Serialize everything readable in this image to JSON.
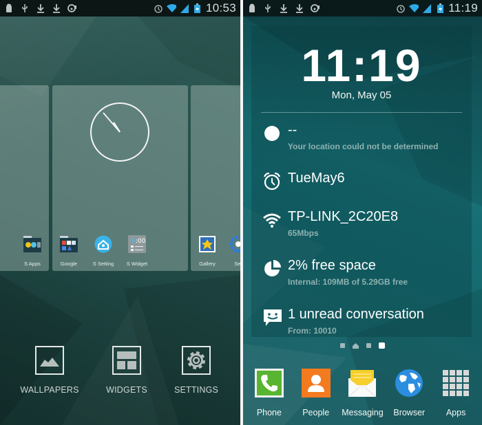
{
  "left_screen": {
    "status_bar": {
      "notification_icons": [
        "android-debug-icon",
        "usb-icon",
        "download-icon",
        "download-icon",
        "screenshot-icon"
      ],
      "system_icons": [
        "alarm-icon",
        "wifi-icon",
        "signal-icon",
        "battery-charging-icon"
      ],
      "time": "10:53"
    },
    "preview_cards": {
      "left_card_apps": [
        {
          "label": "S Apps",
          "icon": "s-apps-folder-icon"
        }
      ],
      "center_card_apps": [
        {
          "label": "Google",
          "icon": "google-folder-icon"
        },
        {
          "label": "S Setting",
          "icon": "s-setting-icon"
        },
        {
          "label": "S Widget",
          "icon": "s-widget-icon"
        }
      ],
      "right_card_apps": [
        {
          "label": "Gallery",
          "icon": "gallery-icon"
        },
        {
          "label": "Set",
          "icon": "settings-gear-icon"
        }
      ],
      "clock_widget": "analog-clock"
    },
    "options": [
      {
        "label": "WALLPAPERS",
        "icon": "wallpaper-icon"
      },
      {
        "label": "WIDGETS",
        "icon": "widgets-icon"
      },
      {
        "label": "SETTINGS",
        "icon": "settings-icon"
      }
    ]
  },
  "right_screen": {
    "status_bar": {
      "notification_icons": [
        "android-debug-icon",
        "usb-icon",
        "download-icon",
        "download-icon",
        "screenshot-icon"
      ],
      "system_icons": [
        "alarm-icon",
        "wifi-icon",
        "signal-icon",
        "battery-charging-icon"
      ],
      "time": "11:19"
    },
    "widget": {
      "time": "11:19",
      "date": "Mon, May 05",
      "rows": [
        {
          "icon": "weather-circle-icon",
          "title": "--",
          "subtitle": "Your location could not be determined"
        },
        {
          "icon": "alarm-clock-icon",
          "title": "TueMay6",
          "subtitle": ""
        },
        {
          "icon": "wifi-icon",
          "title": "TP-LINK_2C20E8",
          "subtitle": "65Mbps"
        },
        {
          "icon": "pie-chart-icon",
          "title": "2% free space",
          "subtitle": "Internal: 109MB of 5.29GB free"
        },
        {
          "icon": "chat-smiley-icon",
          "title": "1 unread conversation",
          "subtitle": "From: 10010"
        }
      ]
    },
    "pager": {
      "pages": 4,
      "home_index": 1,
      "active_index": 3
    },
    "dock": [
      {
        "label": "Phone",
        "icon": "phone-icon",
        "color": "#58b530"
      },
      {
        "label": "People",
        "icon": "people-icon",
        "color": "#f47a1f"
      },
      {
        "label": "Messaging",
        "icon": "messaging-icon",
        "color": "#f7cf2a"
      },
      {
        "label": "Browser",
        "icon": "browser-globe-icon",
        "color": "#2b8ee0"
      },
      {
        "label": "Apps",
        "icon": "apps-grid-icon",
        "color": "#d9d9d9"
      }
    ]
  }
}
